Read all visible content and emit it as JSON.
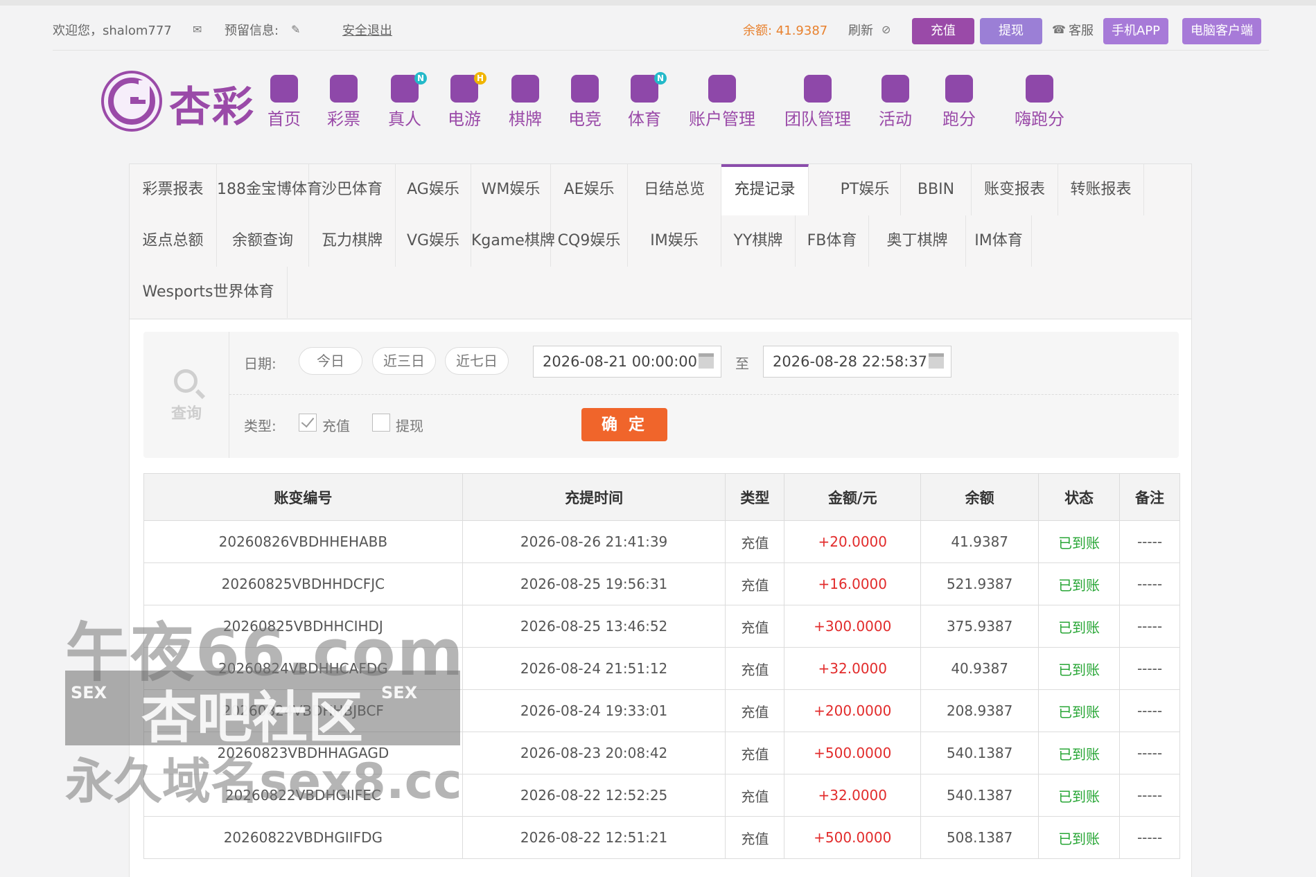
{
  "topbar": {
    "welcome": "欢迎您，shalom777",
    "reserved_info": "预留信息:",
    "logout": "安全退出",
    "balance_label": "余额: 41.9387",
    "refresh": "刷新",
    "recharge_btn": "充值",
    "withdraw_btn": "提现",
    "service": "客服",
    "mobile_app": "手机APP",
    "pc_client": "电脑客户端"
  },
  "logo": {
    "text": "杏彩"
  },
  "nav": [
    {
      "label": "首页",
      "icon": "home-icon"
    },
    {
      "label": "彩票",
      "icon": "ticket-icon"
    },
    {
      "label": "真人",
      "icon": "dealer-icon",
      "badge": "N"
    },
    {
      "label": "电游",
      "icon": "gamepad-icon",
      "badge": "H"
    },
    {
      "label": "棋牌",
      "icon": "cards-icon"
    },
    {
      "label": "电竞",
      "icon": "controller-icon"
    },
    {
      "label": "体育",
      "icon": "trophy-icon",
      "badge": "N"
    },
    {
      "label": "账户管理",
      "icon": "yen-icon"
    },
    {
      "label": "团队管理",
      "icon": "team-icon"
    },
    {
      "label": "活动",
      "icon": "gift-icon"
    },
    {
      "label": "跑分",
      "icon": "rhino-icon"
    },
    {
      "label": "嗨跑分",
      "icon": "hi-icon"
    }
  ],
  "tabs_row1": [
    "彩票报表",
    "188金宝博体育",
    "沙巴体育",
    "AG娱乐",
    "WM娱乐",
    "AE娱乐",
    "日结总览",
    "充提记录",
    "PT娱乐",
    "BBIN",
    "账变报表",
    "转账报表"
  ],
  "tabs_row2": [
    "返点总额",
    "余额查询",
    "瓦力棋牌",
    "VG娱乐",
    "Kgame棋牌",
    "CQ9娱乐",
    "IM娱乐",
    "YY棋牌",
    "FB体育",
    "奥丁棋牌",
    "IM体育"
  ],
  "tabs_row3": [
    "Wesports世界体育"
  ],
  "active_tab": "充提记录",
  "query": {
    "side_label": "查询",
    "date_label": "日期:",
    "today": "今日",
    "three_days": "近三日",
    "seven_days": "近七日",
    "start_date": "2026-08-21 00:00:00",
    "to": "至",
    "end_date": "2026-08-28 22:58:37",
    "type_label": "类型:",
    "type_recharge": "充值",
    "type_withdraw": "提现",
    "recharge_checked": true,
    "withdraw_checked": false,
    "confirm": "确 定"
  },
  "table": {
    "headers": [
      "账变编号",
      "充提时间",
      "类型",
      "金额/元",
      "余额",
      "状态",
      "备注"
    ],
    "rows": [
      [
        "20260826VBDHHEHABB",
        "2026-08-26 21:41:39",
        "充值",
        "+20.0000",
        "41.9387",
        "已到账",
        "-----"
      ],
      [
        "20260825VBDHHDCFJC",
        "2026-08-25 19:56:31",
        "充值",
        "+16.0000",
        "521.9387",
        "已到账",
        "-----"
      ],
      [
        "20260825VBDHHCIHDJ",
        "2026-08-25 13:46:52",
        "充值",
        "+300.0000",
        "375.9387",
        "已到账",
        "-----"
      ],
      [
        "20260824VBDHHCAFDG",
        "2026-08-24 21:51:12",
        "充值",
        "+32.0000",
        "40.9387",
        "已到账",
        "-----"
      ],
      [
        "20260824VBDHHBJBCF",
        "2026-08-24 19:33:01",
        "充值",
        "+200.0000",
        "208.9387",
        "已到账",
        "-----"
      ],
      [
        "20260823VBDHHAGAGD",
        "2026-08-23 20:08:42",
        "充值",
        "+500.0000",
        "540.1387",
        "已到账",
        "-----"
      ],
      [
        "20260822VBDHGIIFEC",
        "2026-08-22 12:52:25",
        "充值",
        "+32.0000",
        "540.1387",
        "已到账",
        "-----"
      ],
      [
        "20260822VBDHGIIFDG",
        "2026-08-22 12:51:21",
        "充值",
        "+500.0000",
        "508.1387",
        "已到账",
        "-----"
      ]
    ]
  },
  "watermark": {
    "line1": "午夜66.com",
    "line2": "杏吧社区",
    "sex_left": "SEX",
    "sex_right": "SEX",
    "line3": "永久域名sex8.cc"
  },
  "colors": {
    "brand_purple": "#9a4aa8",
    "confirm_orange": "#f0652b",
    "amount_red": "#e22b2b",
    "status_green": "#28a636",
    "balance_orange": "#e8812e"
  }
}
